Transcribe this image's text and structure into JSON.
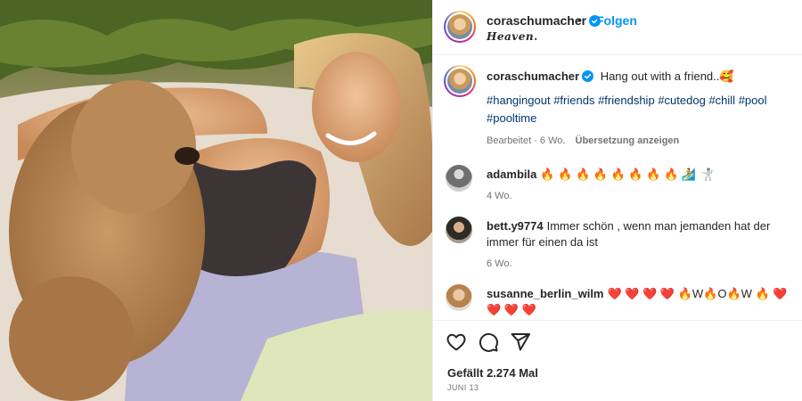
{
  "header": {
    "username": "coraschumacher",
    "separator": "•",
    "follow_label": "Folgen",
    "location": "Heaven."
  },
  "caption": {
    "username": "coraschumacher",
    "text": "Hang out with a friend..🥰",
    "hashtags": [
      "#hangingout",
      "#friends",
      "#friendship",
      "#cutedog",
      "#chill",
      "#pool",
      "#pooltime"
    ],
    "edited": "Bearbeitet · 6 Wo.",
    "translate": "Übersetzung anzeigen"
  },
  "comments": [
    {
      "username": "adambila",
      "text": "🔥 🔥 🔥 🔥 🔥 🔥 🔥 🔥 🏄 🤺",
      "time": "4 Wo."
    },
    {
      "username": "bett.y9774",
      "text": "Immer schön , wenn man jemanden hat der immer für einen da ist",
      "time": "6 Wo."
    },
    {
      "username": "susanne_berlin_wilm",
      "text": "❤️ ❤️ ❤️ ❤️  🔥W🔥O🔥W 🔥 ❤️ ❤️ ❤️ ❤️",
      "time": ""
    }
  ],
  "actions": {
    "icons": [
      "heart-icon",
      "comment-icon",
      "share-icon"
    ],
    "likes": "Gefällt 2.274 Mal",
    "date": "JUNI 13"
  },
  "colors": {
    "link_blue": "#0095f6",
    "hashtag": "#00376b",
    "muted": "#737373",
    "verified": "#0095f6"
  }
}
